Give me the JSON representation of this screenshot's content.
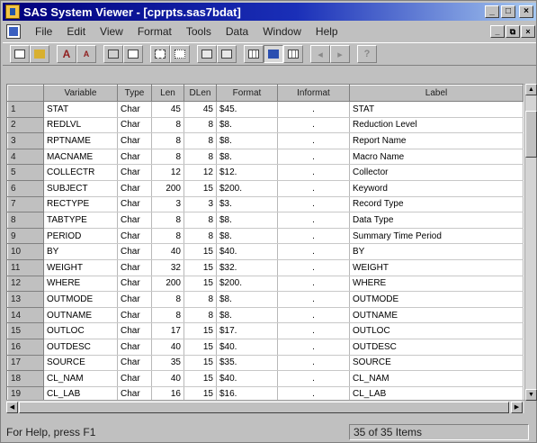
{
  "window": {
    "title": "SAS System Viewer - [cprpts.sas7bdat]",
    "minimize": "_",
    "maximize": "□",
    "close": "×"
  },
  "menu": {
    "items": [
      "File",
      "Edit",
      "View",
      "Format",
      "Tools",
      "Data",
      "Window",
      "Help"
    ],
    "min": "_",
    "restore": "⧉",
    "close": "×"
  },
  "toolbar": {
    "font_large": "A",
    "font_small": "A"
  },
  "table": {
    "headers": [
      "Variable",
      "Type",
      "Len",
      "DLen",
      "Format",
      "Informat",
      "Label"
    ],
    "rows": [
      {
        "num": "1",
        "variable": "STAT",
        "type": "Char",
        "len": "45",
        "dlen": "45",
        "format": "$45.",
        "informat": ".",
        "label": "STAT"
      },
      {
        "num": "2",
        "variable": "REDLVL",
        "type": "Char",
        "len": "8",
        "dlen": "8",
        "format": "$8.",
        "informat": ".",
        "label": "Reduction Level"
      },
      {
        "num": "3",
        "variable": "RPTNAME",
        "type": "Char",
        "len": "8",
        "dlen": "8",
        "format": "$8.",
        "informat": ".",
        "label": "Report Name"
      },
      {
        "num": "4",
        "variable": "MACNAME",
        "type": "Char",
        "len": "8",
        "dlen": "8",
        "format": "$8.",
        "informat": ".",
        "label": "Macro Name"
      },
      {
        "num": "5",
        "variable": "COLLECTR",
        "type": "Char",
        "len": "12",
        "dlen": "12",
        "format": "$12.",
        "informat": ".",
        "label": "Collector"
      },
      {
        "num": "6",
        "variable": "SUBJECT",
        "type": "Char",
        "len": "200",
        "dlen": "15",
        "format": "$200.",
        "informat": ".",
        "label": "Keyword"
      },
      {
        "num": "7",
        "variable": "RECTYPE",
        "type": "Char",
        "len": "3",
        "dlen": "3",
        "format": "$3.",
        "informat": ".",
        "label": "Record Type"
      },
      {
        "num": "8",
        "variable": "TABTYPE",
        "type": "Char",
        "len": "8",
        "dlen": "8",
        "format": "$8.",
        "informat": ".",
        "label": "Data Type"
      },
      {
        "num": "9",
        "variable": "PERIOD",
        "type": "Char",
        "len": "8",
        "dlen": "8",
        "format": "$8.",
        "informat": ".",
        "label": "Summary Time Period"
      },
      {
        "num": "10",
        "variable": "BY",
        "type": "Char",
        "len": "40",
        "dlen": "15",
        "format": "$40.",
        "informat": ".",
        "label": "BY"
      },
      {
        "num": "11",
        "variable": "WEIGHT",
        "type": "Char",
        "len": "32",
        "dlen": "15",
        "format": "$32.",
        "informat": ".",
        "label": "WEIGHT"
      },
      {
        "num": "12",
        "variable": "WHERE",
        "type": "Char",
        "len": "200",
        "dlen": "15",
        "format": "$200.",
        "informat": ".",
        "label": "WHERE"
      },
      {
        "num": "13",
        "variable": "OUTMODE",
        "type": "Char",
        "len": "8",
        "dlen": "8",
        "format": "$8.",
        "informat": ".",
        "label": "OUTMODE"
      },
      {
        "num": "14",
        "variable": "OUTNAME",
        "type": "Char",
        "len": "8",
        "dlen": "8",
        "format": "$8.",
        "informat": ".",
        "label": "OUTNAME"
      },
      {
        "num": "15",
        "variable": "OUTLOC",
        "type": "Char",
        "len": "17",
        "dlen": "15",
        "format": "$17.",
        "informat": ".",
        "label": "OUTLOC"
      },
      {
        "num": "16",
        "variable": "OUTDESC",
        "type": "Char",
        "len": "40",
        "dlen": "15",
        "format": "$40.",
        "informat": ".",
        "label": "OUTDESC"
      },
      {
        "num": "17",
        "variable": "SOURCE",
        "type": "Char",
        "len": "35",
        "dlen": "15",
        "format": "$35.",
        "informat": ".",
        "label": "SOURCE"
      },
      {
        "num": "18",
        "variable": "CL_NAM",
        "type": "Char",
        "len": "40",
        "dlen": "15",
        "format": "$40.",
        "informat": ".",
        "label": "CL_NAM"
      },
      {
        "num": "19",
        "variable": "CL_LAB",
        "type": "Char",
        "len": "16",
        "dlen": "15",
        "format": "$16.",
        "informat": ".",
        "label": "CL_LAB"
      }
    ]
  },
  "status": {
    "help": "For Help, press F1",
    "count": "35 of 35 Items"
  },
  "scroll": {
    "up": "▲",
    "down": "▼",
    "left": "◀",
    "right": "▶"
  }
}
